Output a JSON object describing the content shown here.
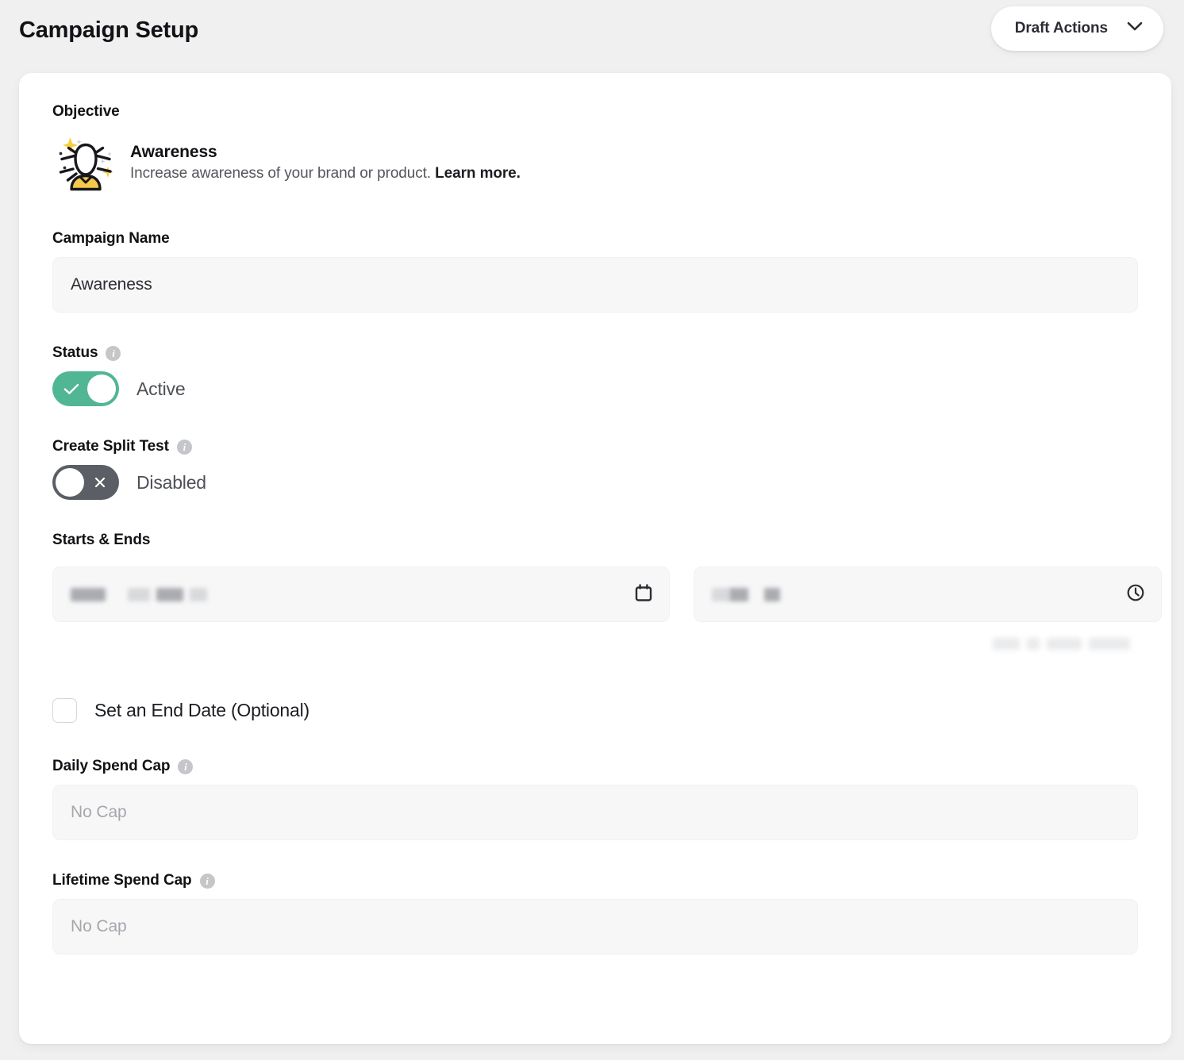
{
  "header": {
    "title": "Campaign Setup",
    "draft_actions_label": "Draft Actions",
    "chevron_icon": "chevron-down-icon"
  },
  "objective": {
    "label": "Objective",
    "icon": "awareness-person-icon",
    "title": "Awareness",
    "description": "Increase awareness of your brand or product.",
    "learn_more": "Learn more."
  },
  "campaign_name": {
    "label": "Campaign Name",
    "value": "Awareness",
    "placeholder": "Campaign Name"
  },
  "status": {
    "label": "Status",
    "info_icon": "info-icon",
    "toggle_state": "on",
    "toggle_glyph": "check-icon",
    "state_label": "Active"
  },
  "split_test": {
    "label": "Create Split Test",
    "info_icon": "info-icon",
    "toggle_state": "off",
    "toggle_glyph": "close-icon",
    "state_label": "Disabled"
  },
  "starts_ends": {
    "label": "Starts & Ends",
    "start_date": {
      "value": "",
      "redacted": true,
      "icon": "calendar-icon"
    },
    "start_time": {
      "value": "",
      "redacted": true,
      "icon": "clock-icon"
    },
    "timezone_helper": {
      "value": "",
      "redacted": true
    },
    "end_date_checkbox": {
      "label": "Set an End Date (Optional)",
      "checked": false
    }
  },
  "daily_spend_cap": {
    "label": "Daily Spend Cap",
    "info_icon": "info-icon",
    "value": "",
    "placeholder": "No Cap"
  },
  "lifetime_spend_cap": {
    "label": "Lifetime Spend Cap",
    "info_icon": "info-icon",
    "value": "",
    "placeholder": "No Cap"
  },
  "colors": {
    "page_background": "#f0f0f0",
    "card_background": "#ffffff",
    "input_background": "#f7f7f8",
    "toggle_on": "#50b694",
    "toggle_off": "#5b5e64",
    "text_primary": "#111215",
    "text_secondary": "#53565c",
    "placeholder": "#a5a7ac",
    "accent_yellow": "#f7c948"
  }
}
